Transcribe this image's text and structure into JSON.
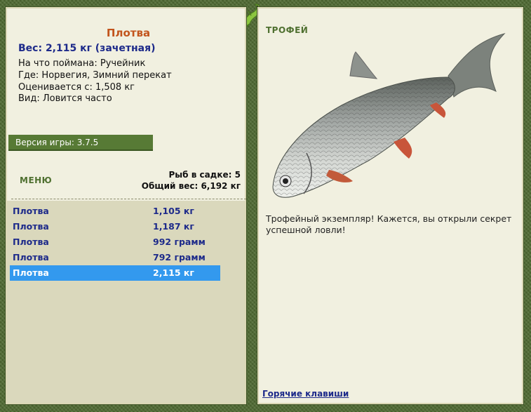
{
  "fish": {
    "name": "Плотва",
    "weight_line": "Вес: 2,115 кг (зачетная)",
    "bait": "На что поймана: Ручейник",
    "location": "Где: Норвегия, Зимний перекат",
    "value": "Оценивается с: 1,508 кг",
    "kind": "Вид: Ловится часто"
  },
  "version": "Версия игры: 3.7.5",
  "menu_label": "МЕНЮ",
  "keep": {
    "count_line": "Рыб в садке: 5",
    "total_line": "Общий вес: 6,192 кг"
  },
  "catch_list": [
    {
      "name": "Плотва",
      "weight": "1,105 кг",
      "selected": false
    },
    {
      "name": "Плотва",
      "weight": "1,187 кг",
      "selected": false
    },
    {
      "name": "Плотва",
      "weight": "992 грамм",
      "selected": false
    },
    {
      "name": "Плотва",
      "weight": "792 грамм",
      "selected": false
    },
    {
      "name": "Плотва",
      "weight": "2,115 кг",
      "selected": true
    }
  ],
  "trophy": {
    "label": "ТРОФЕЙ",
    "description": "Трофейный экземпляр! Кажется, вы открыли секрет успешной ловли!",
    "hotkeys": "Горячие клавиши"
  },
  "colors": {
    "accent_green": "#577a35",
    "title_orange": "#c2541c",
    "link_blue": "#1d2a8a",
    "selection_blue": "#3399ee"
  }
}
